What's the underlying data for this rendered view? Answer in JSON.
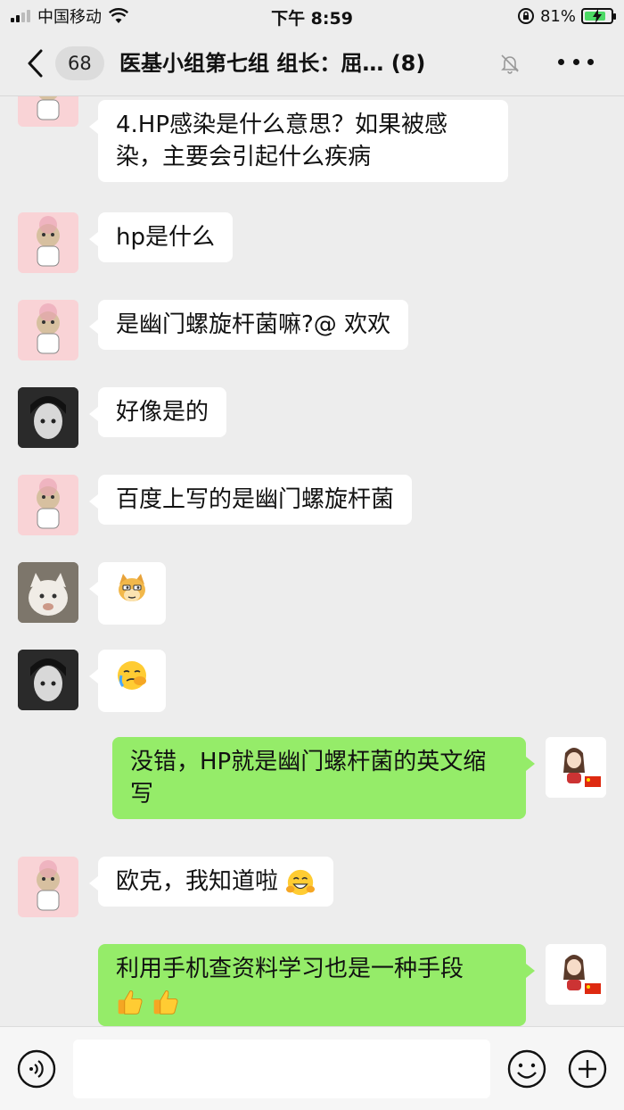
{
  "status_bar": {
    "carrier": "中国移动",
    "time": "下午 8:59",
    "battery": "81%",
    "battery_level": 0.81,
    "icons": [
      "signal-icon",
      "wifi-icon",
      "rotation-lock-icon",
      "battery-charging-icon"
    ]
  },
  "nav": {
    "unread_count": "68",
    "title": "医基小组第七组   组长：屈…  (8)",
    "icons": [
      "back-arrow-icon",
      "mute-bell-icon",
      "more-dots-icon"
    ]
  },
  "messages": [
    {
      "side": "in",
      "avatar": "pink-cartoon-avatar",
      "text": "4.HP感染是什么意思？如果被感染，主要会引起什么疾病"
    },
    {
      "side": "in",
      "avatar": "pink-cartoon-avatar",
      "text": "hp是什么"
    },
    {
      "side": "in",
      "avatar": "pink-cartoon-avatar",
      "text": "是幽门螺旋杆菌嘛?@ 欢欢"
    },
    {
      "side": "in",
      "avatar": "dark-anime-avatar",
      "text": "好像是的"
    },
    {
      "side": "in",
      "avatar": "pink-cartoon-avatar",
      "text": "百度上写的是幽门螺旋杆菌"
    },
    {
      "side": "in",
      "avatar": "cat-photo-avatar",
      "emoji": "doge-emoji"
    },
    {
      "side": "in",
      "avatar": "dark-anime-avatar",
      "emoji": "facepalm-cry-emoji"
    },
    {
      "side": "out",
      "avatar": "girl-flag-avatar",
      "text": "没错，HP就是幽门螺杆菌的英文缩写"
    },
    {
      "side": "in",
      "avatar": "pink-cartoon-avatar",
      "text": "欧克，我知道啦",
      "emoji": "grin-emoji"
    },
    {
      "side": "out",
      "avatar": "girl-flag-avatar",
      "text": "利用手机查资料学习也是一种手段",
      "emoji": "thumbs-up-emoji"
    }
  ],
  "input_bar": {
    "placeholder": "",
    "icons": [
      "voice-icon",
      "emoji-icon",
      "plus-icon"
    ]
  }
}
